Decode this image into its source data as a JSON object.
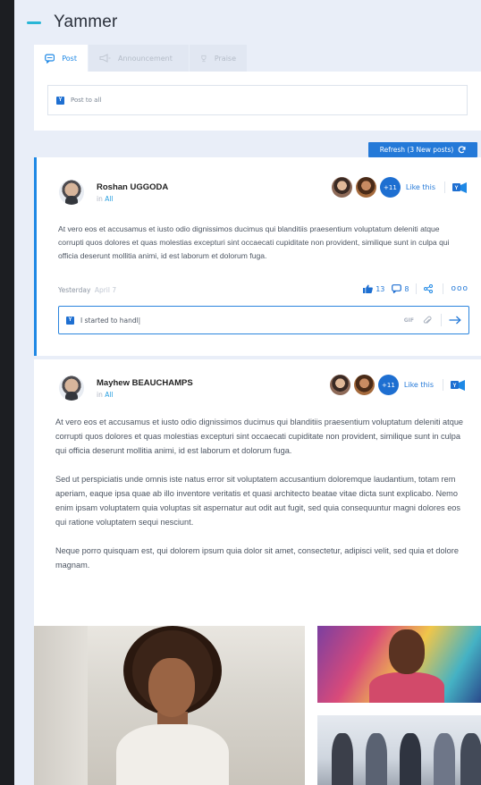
{
  "app": {
    "title": "Yammer"
  },
  "compose": {
    "tabs": [
      {
        "label": "Post",
        "icon": "chat-bubble-icon",
        "active": true
      },
      {
        "label": "Announcement",
        "icon": "megaphone-icon",
        "active": false
      },
      {
        "label": "Praise",
        "icon": "trophy-icon",
        "active": false
      }
    ],
    "placeholder": "Post to all",
    "badge": "Y"
  },
  "refresh": {
    "label": "Refresh (3 New posts)",
    "icon": "refresh-icon"
  },
  "posts": [
    {
      "author": "Roshan UGGODA",
      "in_prefix": "in",
      "group": "All",
      "likers_more": "+11",
      "like_label": "Like this",
      "text": "At vero eos et accusamus et iusto odio dignissimos ducimus qui blanditiis praesentium voluptatum deleniti atque corrupti quos dolores et quas molestias excepturi sint occaecati cupiditate non provident, similique sunt in culpa qui officia deserunt mollitia animi, id est laborum et dolorum fuga.",
      "date_primary": "Yesterday",
      "date_secondary": "April 7",
      "likes": "13",
      "comments": "8",
      "more": "ooo",
      "reply": {
        "value": "I started to handl|",
        "gif_label": "GIF",
        "badge": "Y"
      }
    },
    {
      "author": "Mayhew BEAUCHAMPS",
      "in_prefix": "in",
      "group": "All",
      "likers_more": "+11",
      "like_label": "Like this",
      "paragraphs": [
        "At vero eos et accusamus et iusto odio dignissimos ducimus qui blanditiis praesentium voluptatum deleniti atque corrupti quos dolores et quas molestias excepturi sint occaecati cupiditate non provident, similique sunt in culpa qui officia deserunt mollitia animi, id est laborum et dolorum fuga.",
        "Sed ut perspiciatis unde omnis iste natus error sit voluptatem accusantium doloremque laudantium, totam rem aperiam, eaque ipsa quae ab illo inventore veritatis et quasi architecto beatae vitae dicta sunt explicabo. Nemo enim ipsam voluptatem quia voluptas sit aspernatur aut odit aut fugit, sed quia consequuntur magni dolores eos qui ratione voluptatem sequi nesciunt.",
        "Neque porro quisquam est, qui dolorem ipsum quia dolor sit amet, consectetur, adipisci velit, sed quia et dolore magnam."
      ]
    }
  ],
  "colors": {
    "accent": "#1e88e5",
    "brand": "#1e6fd1",
    "header_dash": "#29b6d6",
    "panel_bg": "#e9eef8"
  }
}
